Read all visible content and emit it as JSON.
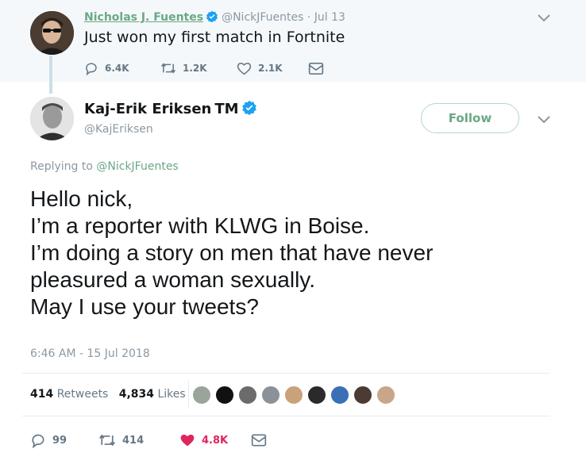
{
  "parent_tweet": {
    "display_name": "Nicholas J. Fuentes",
    "handle_date": "@NickJFuentes · Jul 13",
    "text": "Just won my first match in Fortnite",
    "actions": {
      "replies": "6.4K",
      "retweets": "1.2K",
      "likes": "2.1K"
    }
  },
  "main_tweet": {
    "display_name": "Kaj-Erik Eriksen",
    "name_suffix": "TM",
    "handle": "@KajEriksen",
    "follow_label": "Follow",
    "replying_prefix": "Replying to",
    "replying_to": "@NickJFuentes",
    "text_lines": [
      "Hello nick,",
      "I’m a reporter with KLWG in Boise.",
      "I’m doing a story on men that have never",
      "pleasured a woman sexually.",
      "May I use your tweets?"
    ],
    "timestamp": "6:46 AM - 15 Jul 2018",
    "stats": {
      "retweets_count": "414",
      "retweets_label": "Retweets",
      "likes_count": "4,834",
      "likes_label": "Likes"
    },
    "liker_avatar_colors": [
      "#9aa49a",
      "#111111",
      "#6b6b6b",
      "#8a9198",
      "#c9a27a",
      "#2a2a2a",
      "#3b6fb6",
      "#4b3b33",
      "#c9a58a"
    ],
    "actions": {
      "replies": "99",
      "retweets": "414",
      "likes": "4.8K"
    }
  },
  "colors": {
    "link_green": "#6aa886",
    "verified_blue": "#1da1f2",
    "like_red": "#e0245e",
    "muted_gray": "#8b98a3"
  }
}
